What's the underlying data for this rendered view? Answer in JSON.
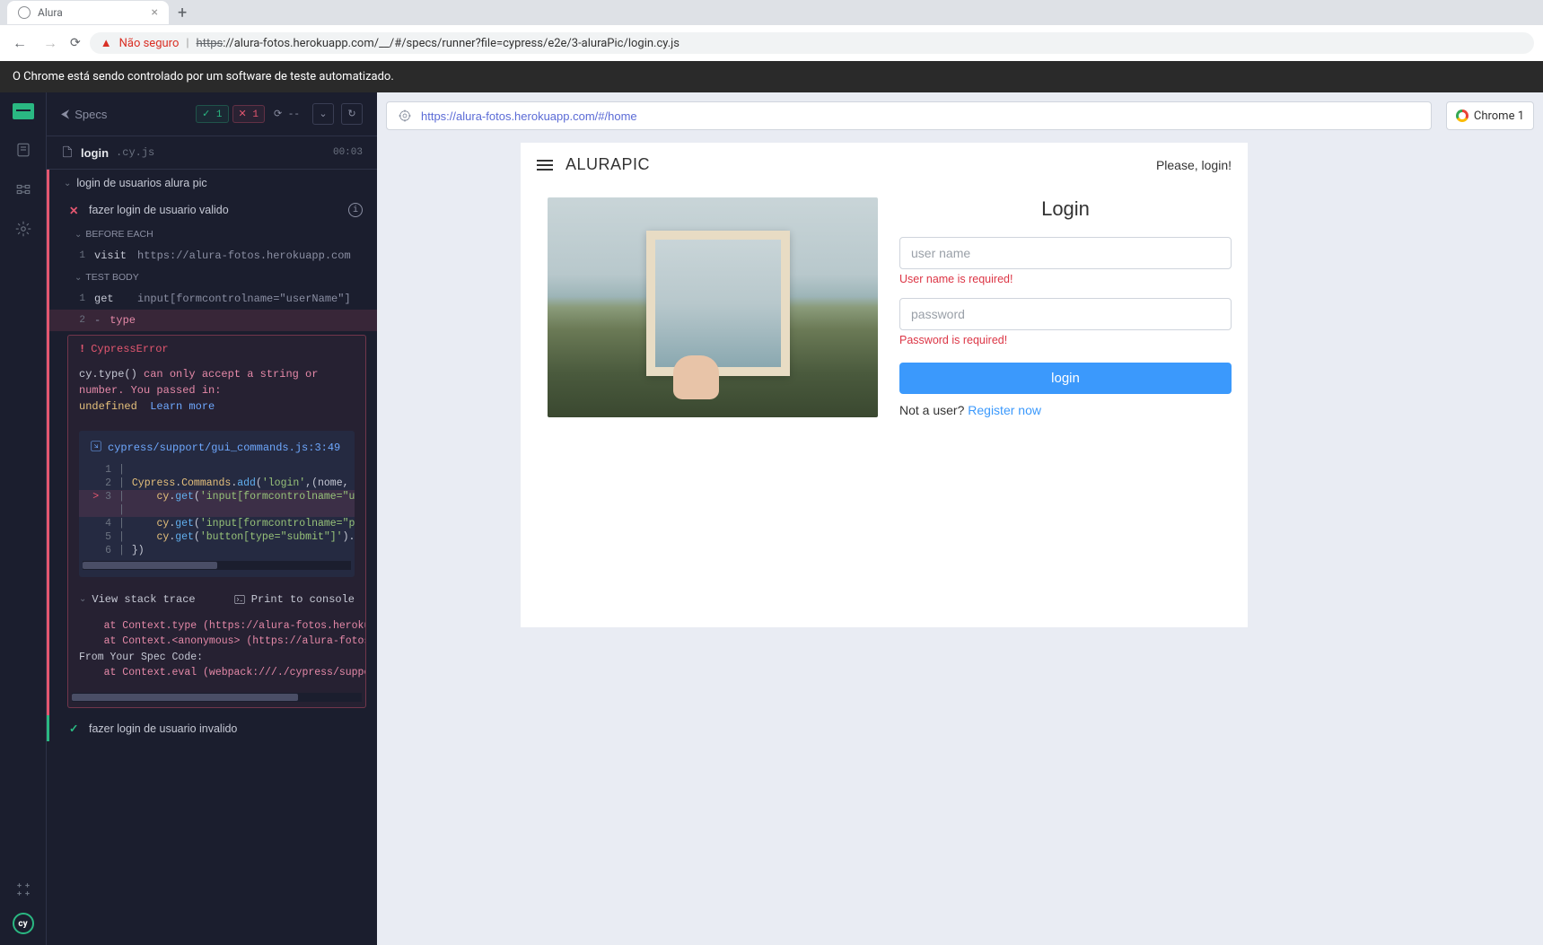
{
  "browser": {
    "tab_title": "Alura",
    "not_secure_label": "Não seguro",
    "url_protocol": "https",
    "url_host_path": "://alura-fotos.herokuapp.com/__/#/specs/runner?file=cypress/e2e/3-aluraPic/login.cy.js",
    "automation_banner": "O Chrome está sendo controlado por um software de teste automatizado."
  },
  "runner": {
    "specs_label": "Specs",
    "stats": {
      "pass": "1",
      "fail": "1",
      "pending_dash": "--"
    },
    "spec_file_name": "login",
    "spec_file_ext": ".cy.js",
    "elapsed": "00:03",
    "suite_name": "login de usuarios alura pic",
    "test_fail_name": "fazer login de usuario valido",
    "hooks": {
      "before_each": "BEFORE EACH",
      "test_body": "TEST BODY"
    },
    "commands": [
      {
        "num": "1",
        "name": "visit",
        "args": "https://alura-fotos.herokuapp.com"
      },
      {
        "num": "1",
        "name": "get",
        "args": "input[formcontrolname=\"userName\"]"
      },
      {
        "num": "2",
        "name": "type",
        "args": "",
        "active": true,
        "dash": "-"
      }
    ],
    "error": {
      "type": "CypressError",
      "msg_prefix": "cy.type()",
      "msg_text1": " can only accept a string or number. You passed in: ",
      "msg_undefined": "undefined",
      "learn_more": "Learn more",
      "file_link": "cypress/support/gui_commands.js:3:49",
      "code_lines": [
        {
          "n": "1",
          "text": "",
          "hl": false
        },
        {
          "n": "2",
          "text": "Cypress.Commands.add('login',(nome, senha) => {",
          "hl": false
        },
        {
          "n": "3",
          "text": "    cy.get('input[formcontrolname=\"userName\"]'",
          "hl": true,
          "ptr": true
        },
        {
          "n": "",
          "text": "",
          "hl": true
        },
        {
          "n": "4",
          "text": "    cy.get('input[formcontrolname=\"password\"]'",
          "hl": false
        },
        {
          "n": "5",
          "text": "    cy.get('button[type=\"submit\"]').click();",
          "hl": false
        },
        {
          "n": "6",
          "text": "})",
          "hl": false
        }
      ],
      "view_stack": "View stack trace",
      "print_console": "Print to console",
      "stack": [
        "    at Context.type (https://alura-fotos.herokuapp.com/__cyp",
        "    at Context.<anonymous> (https://alura-fotos.herokuapp.co",
        "From Your Spec Code:",
        "    at Context.eval (webpack:///./cypress/support/gui_comman"
      ]
    },
    "test_pass_name": "fazer login de usuario invalido"
  },
  "aut": {
    "url": "https://alura-fotos.herokuapp.com/#/home",
    "browser_badge": "Chrome 1",
    "brand": "ALURAPIC",
    "please_login": "Please, login!",
    "login_title": "Login",
    "username_placeholder": "user name",
    "username_error": "User name is required!",
    "password_placeholder": "password",
    "password_error": "Password is required!",
    "login_button": "login",
    "not_a_user": "Not a user? ",
    "register_now": "Register now"
  }
}
